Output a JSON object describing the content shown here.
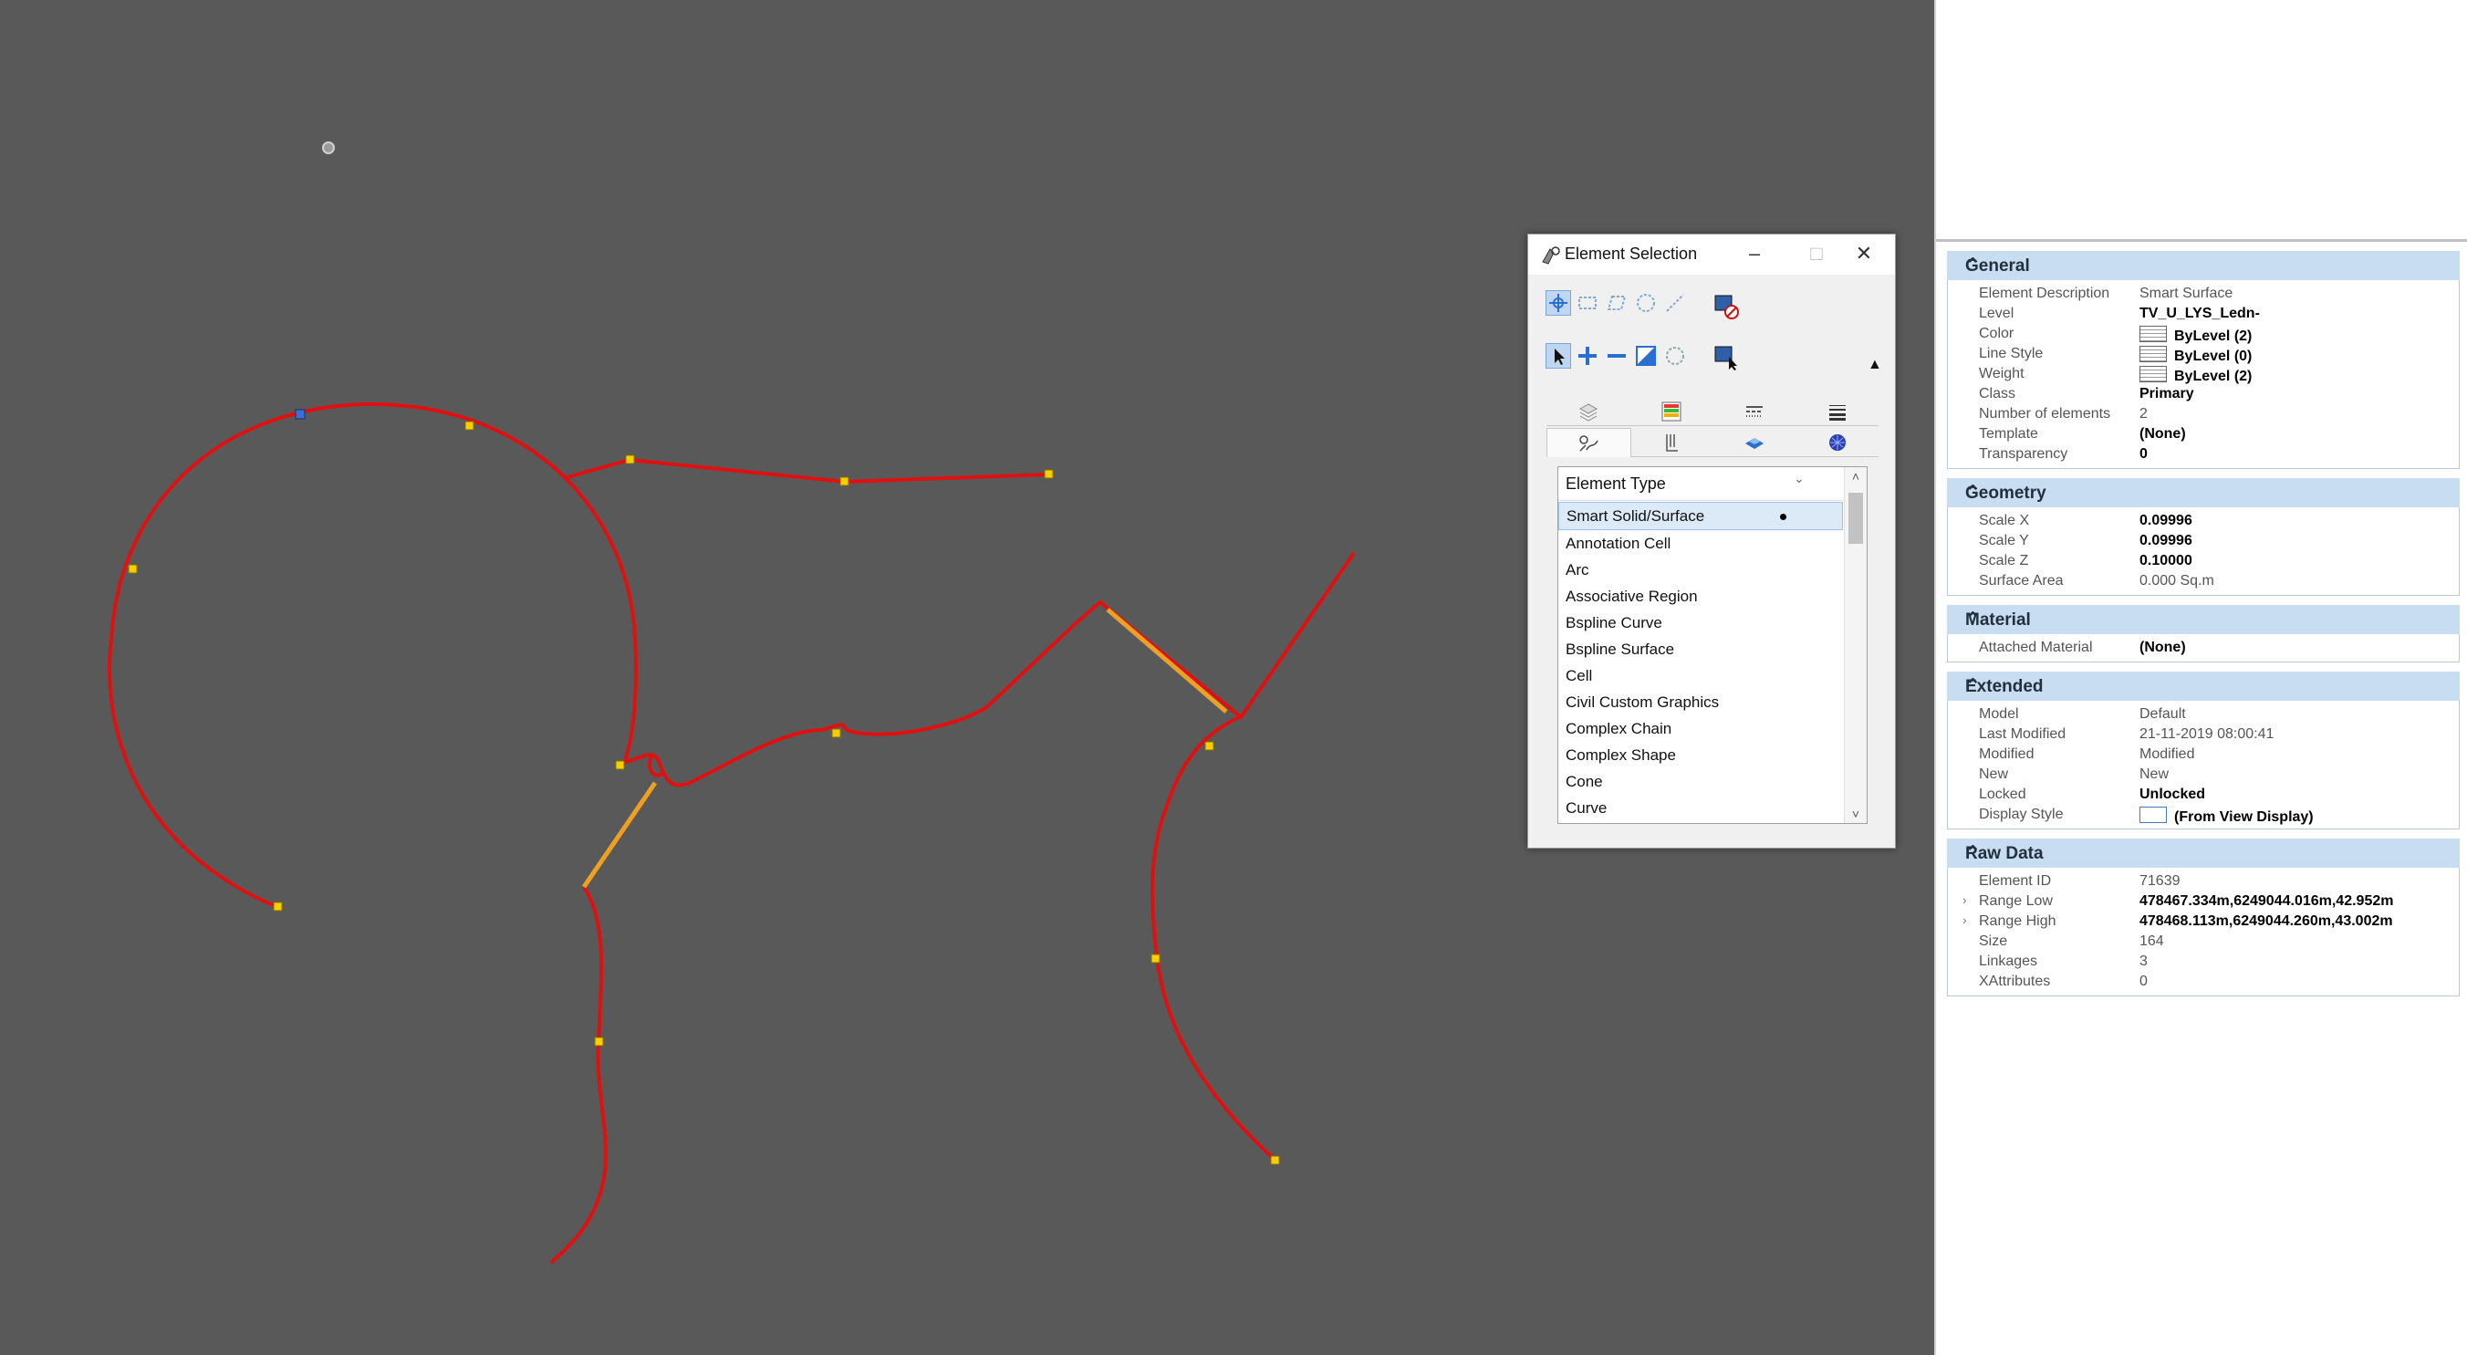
{
  "dialog": {
    "title": "Element Selection",
    "list_header": "Element Type",
    "element_types": [
      {
        "label": "Smart Solid/Surface",
        "selected": true
      },
      {
        "label": "Annotation Cell"
      },
      {
        "label": "Arc"
      },
      {
        "label": "Associative Region"
      },
      {
        "label": "Bspline Curve"
      },
      {
        "label": "Bspline Surface"
      },
      {
        "label": "Cell"
      },
      {
        "label": "Civil Custom Graphics"
      },
      {
        "label": "Complex Chain"
      },
      {
        "label": "Complex Shape"
      },
      {
        "label": "Cone"
      },
      {
        "label": "Curve"
      }
    ]
  },
  "properties": {
    "general": {
      "header": "General",
      "rows": [
        {
          "label": "Element Description",
          "value": "Smart Surface"
        },
        {
          "label": "Level",
          "value": "TV_U_LYS_Ledn-"
        },
        {
          "label": "Color",
          "value": "ByLevel (2)"
        },
        {
          "label": "Line Style",
          "value": "ByLevel (0)"
        },
        {
          "label": "Weight",
          "value": "ByLevel (2)"
        },
        {
          "label": "Class",
          "value": "Primary"
        },
        {
          "label": "Number of elements",
          "value": "2"
        },
        {
          "label": "Template",
          "value": "(None)"
        },
        {
          "label": "Transparency",
          "value": "0"
        }
      ]
    },
    "geometry": {
      "header": "Geometry",
      "rows": [
        {
          "label": "Scale X",
          "value": "0.09996"
        },
        {
          "label": "Scale Y",
          "value": "0.09996"
        },
        {
          "label": "Scale Z",
          "value": "0.10000"
        },
        {
          "label": "Surface Area",
          "value": "0.000 Sq.m"
        }
      ]
    },
    "material": {
      "header": "Material",
      "rows": [
        {
          "label": "Attached Material",
          "value": "(None)"
        }
      ]
    },
    "extended": {
      "header": "Extended",
      "rows": [
        {
          "label": "Model",
          "value": "Default"
        },
        {
          "label": "Last Modified",
          "value": "21-11-2019 08:00:41"
        },
        {
          "label": "Modified",
          "value": "Modified"
        },
        {
          "label": "New",
          "value": "New"
        },
        {
          "label": "Locked",
          "value": "Unlocked"
        },
        {
          "label": "Display Style",
          "value": "(From View Display)"
        }
      ]
    },
    "rawdata": {
      "header": "Raw Data",
      "rows": [
        {
          "label": "Element ID",
          "value": "71639"
        },
        {
          "label": "Range Low",
          "value": "478467.334m,6249044.016m,42.952m"
        },
        {
          "label": "Range High",
          "value": "478468.113m,6249044.260m,43.002m"
        },
        {
          "label": "Size",
          "value": "164"
        },
        {
          "label": "Linkages",
          "value": "3"
        },
        {
          "label": "XAttributes",
          "value": "0"
        }
      ]
    }
  },
  "colors": {
    "viewport_bg": "#595959",
    "curve_red": "#e01010",
    "segment_orange": "#f0a020",
    "vertex_yellow": "#f5d000",
    "section_header": "#c8dcf2"
  }
}
